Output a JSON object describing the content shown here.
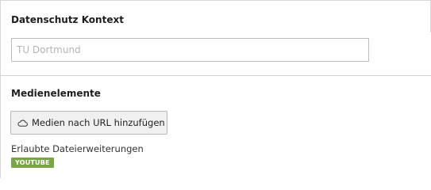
{
  "privacy_context": {
    "label": "Datenschutz Kontext",
    "input_value": "",
    "input_placeholder": "TU Dortmund"
  },
  "media_elements": {
    "label": "Medienelemente",
    "add_button": {
      "label": "Medien nach URL hinzufügen",
      "icon": "cloud-icon"
    },
    "allowed_extensions_label": "Erlaubte Dateierweiterungen",
    "allowed_extensions": [
      "YOUTUBE"
    ],
    "badge_color": "#79a548"
  }
}
